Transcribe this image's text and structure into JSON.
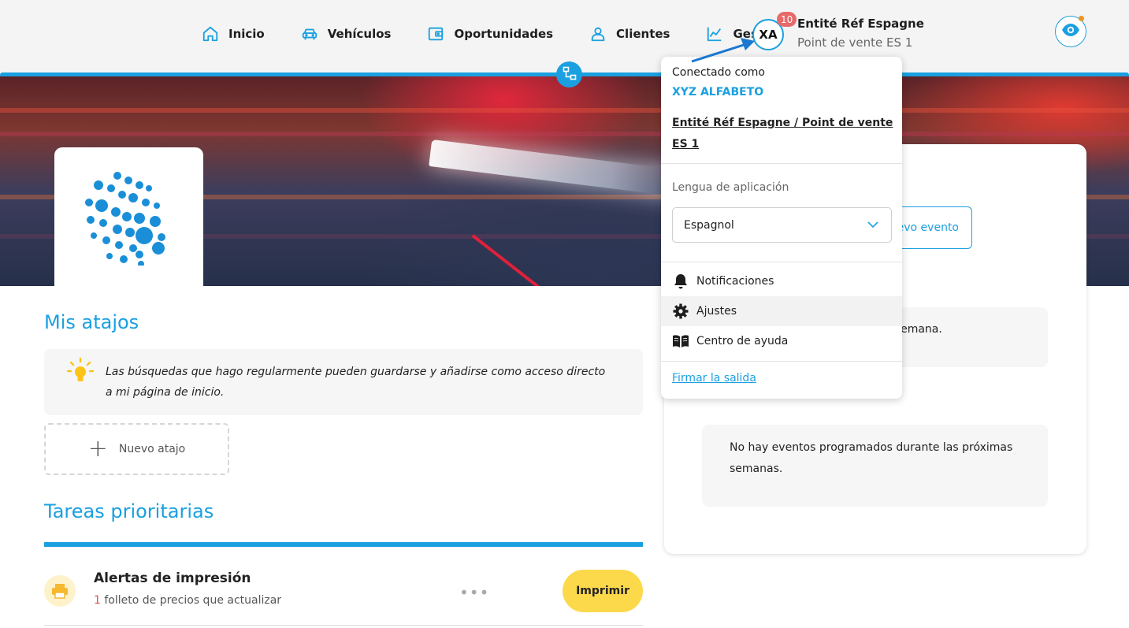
{
  "nav": {
    "items": [
      {
        "label": "Inicio",
        "icon": "home-icon"
      },
      {
        "label": "Vehículos",
        "icon": "car-icon"
      },
      {
        "label": "Oportunidades",
        "icon": "wallet-icon"
      },
      {
        "label": "Clientes",
        "icon": "user-icon"
      },
      {
        "label": "Gestión",
        "icon": "chart-line-icon"
      }
    ]
  },
  "user": {
    "initials": "XA",
    "notification_count": "10",
    "entity": "Entité Réf Espagne",
    "point_of_sale": "Point de vente ES 1"
  },
  "dropdown": {
    "connected_as_label": "Conectado como",
    "user_name": "XYZ ALFABETO",
    "entity_link": "Entité Réf Espagne / Point de vente ES 1",
    "language_label": "Lengua de aplicación",
    "language_value": "Espagnol",
    "items": [
      {
        "label": "Notificaciones",
        "icon": "bell-icon"
      },
      {
        "label": "Ajustes",
        "icon": "gear-icon"
      },
      {
        "label": "Centro de ayuda",
        "icon": "book-icon"
      }
    ],
    "logout": "Firmar la salida"
  },
  "shortcuts": {
    "title": "Mis atajos",
    "tip": "Las búsquedas que hago regularmente pueden guardarse y añadirse como acceso directo a mi página de inicio.",
    "new_label": "Nuevo atajo"
  },
  "tasks": {
    "title": "Tareas prioritarias",
    "items": [
      {
        "title": "Alertas de impresión",
        "count": "1",
        "subtitle": " folleto de precios que actualizar",
        "action": "Imprimir"
      }
    ]
  },
  "events": {
    "new_event_partial": "evo evento",
    "week_partial": "sta semana.",
    "no_events": "No hay eventos programados durante las próximas semanas."
  },
  "colors": {
    "accent": "#1aa0e0",
    "badge": "#e86a6a",
    "print_button": "#fcd94a",
    "notification_dot": "#f0941e"
  }
}
